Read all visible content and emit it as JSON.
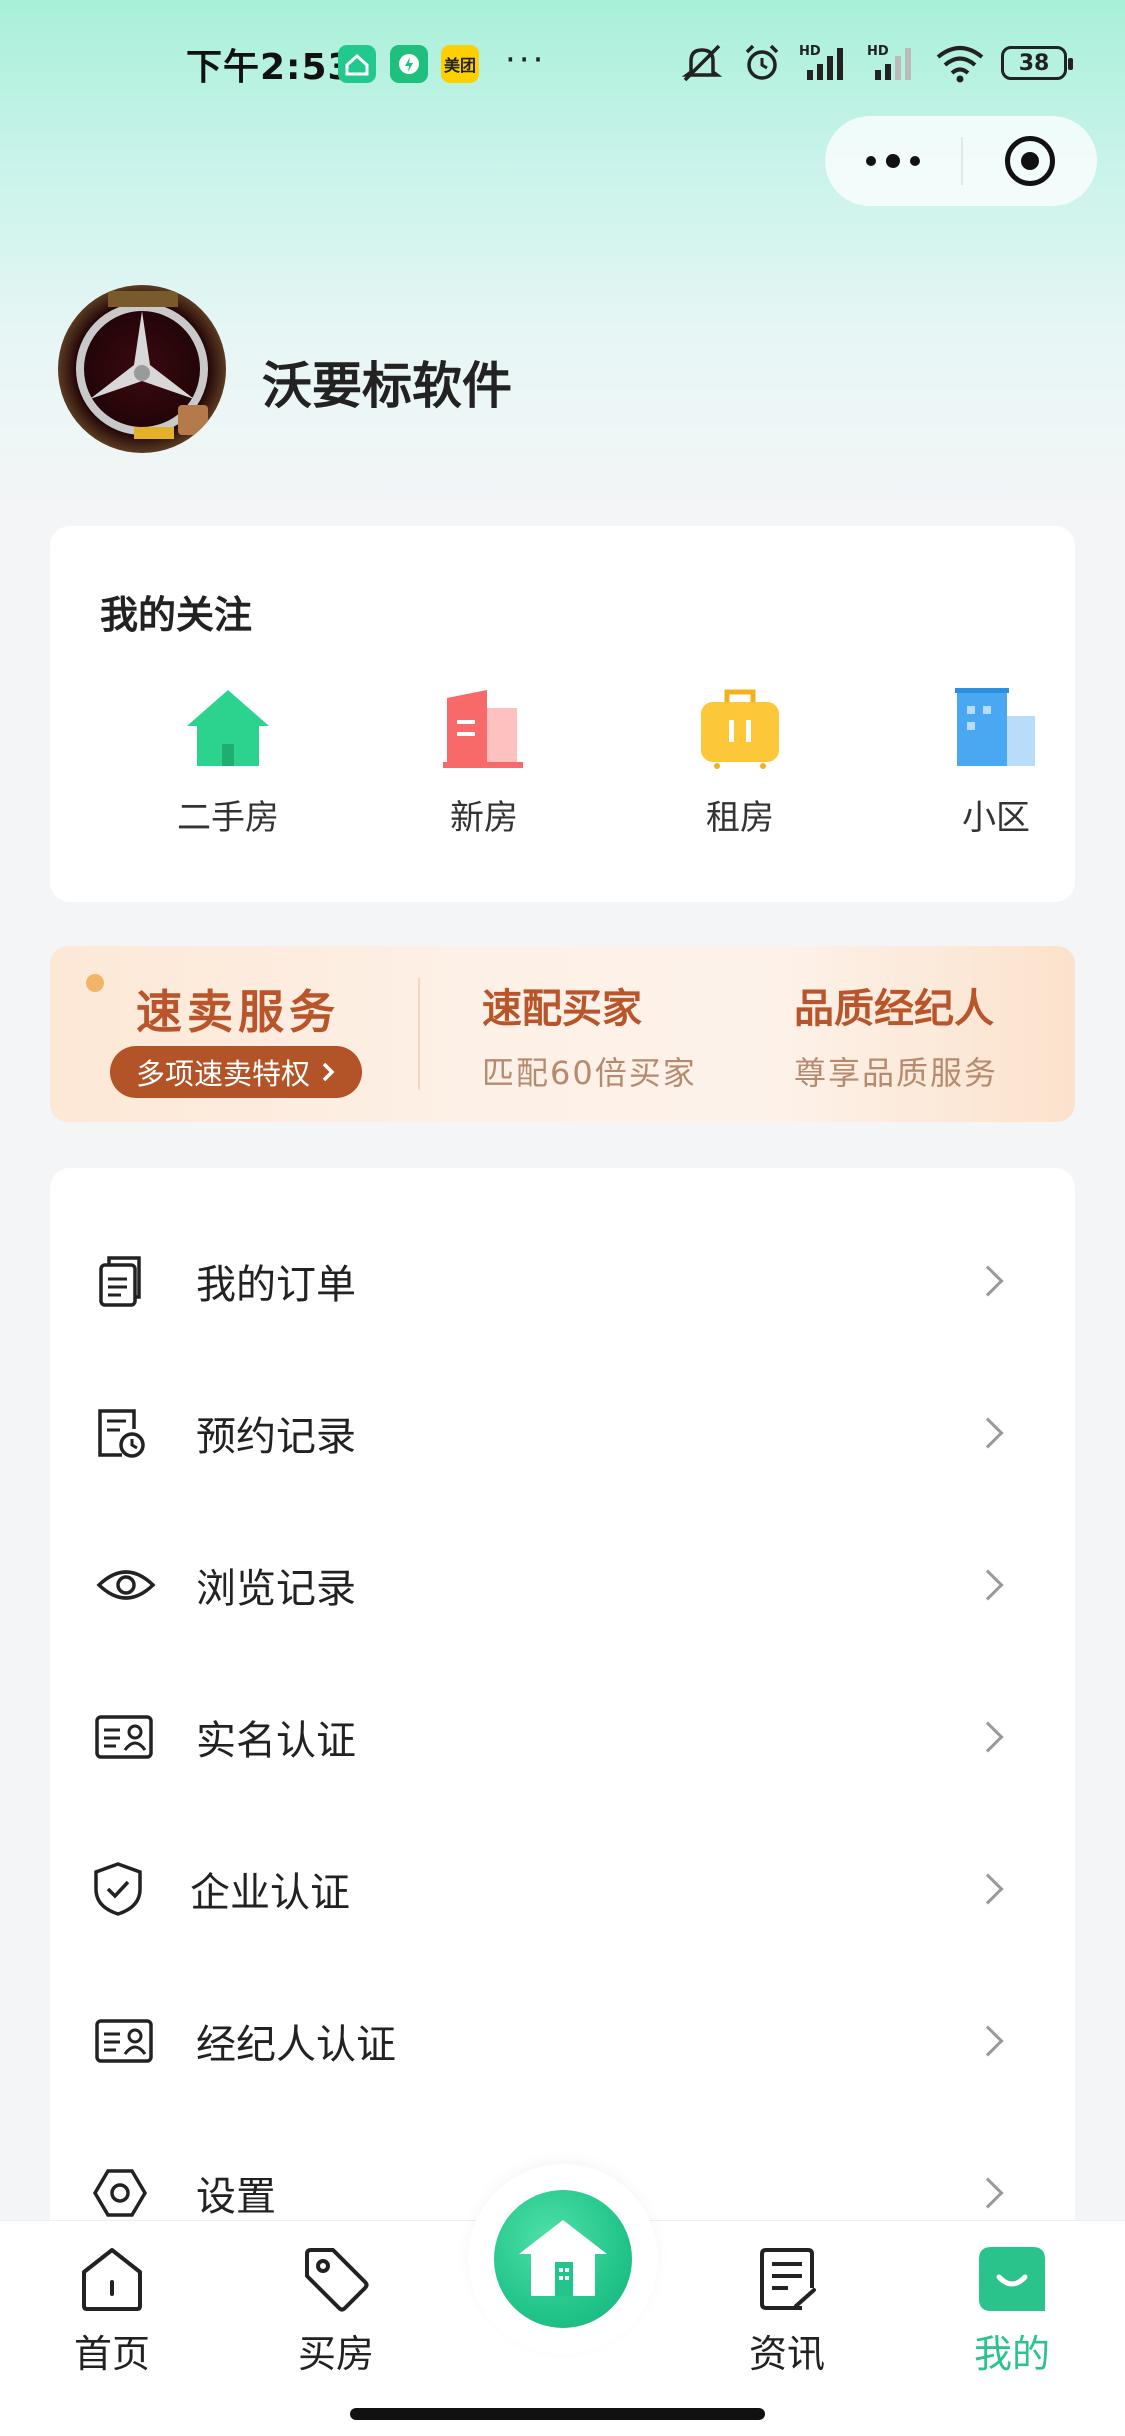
{
  "status_bar": {
    "time": "下午2:53",
    "app_badge_meituan": "美团",
    "more": "···",
    "battery": "38"
  },
  "profile": {
    "name": "沃要标软件"
  },
  "follow": {
    "title": "我的关注",
    "items": [
      {
        "label": "二手房",
        "icon": "house-icon",
        "color": "#2bd38f"
      },
      {
        "label": "新房",
        "icon": "building-icon",
        "color": "#f86a6a"
      },
      {
        "label": "租房",
        "icon": "suitcase-icon",
        "color": "#fdc73a"
      },
      {
        "label": "小区",
        "icon": "apartment-icon",
        "color": "#4aa7f2"
      }
    ]
  },
  "banner": {
    "title": "速卖服务",
    "pill": "多项速卖特权",
    "col1_title": "速配买家",
    "col1_sub": "匹配60倍买家",
    "col2_title": "品质经纪人",
    "col2_sub": "尊享品质服务"
  },
  "menu": [
    {
      "label": "我的订单",
      "icon": "document-icon"
    },
    {
      "label": "预约记录",
      "icon": "appointment-icon"
    },
    {
      "label": "浏览记录",
      "icon": "eye-icon"
    },
    {
      "label": "实名认证",
      "icon": "id-card-icon"
    },
    {
      "label": "企业认证",
      "icon": "shield-check-icon"
    },
    {
      "label": "经纪人认证",
      "icon": "id-card-icon"
    },
    {
      "label": "设置",
      "icon": "settings-icon"
    }
  ],
  "tabbar": {
    "tabs": [
      {
        "label": "首页",
        "icon": "home-icon"
      },
      {
        "label": "买房",
        "icon": "tag-icon"
      },
      {
        "label": "资讯",
        "icon": "news-icon"
      },
      {
        "label": "我的",
        "icon": "profile-icon",
        "active": true
      }
    ],
    "accent": "#2bc38c"
  }
}
